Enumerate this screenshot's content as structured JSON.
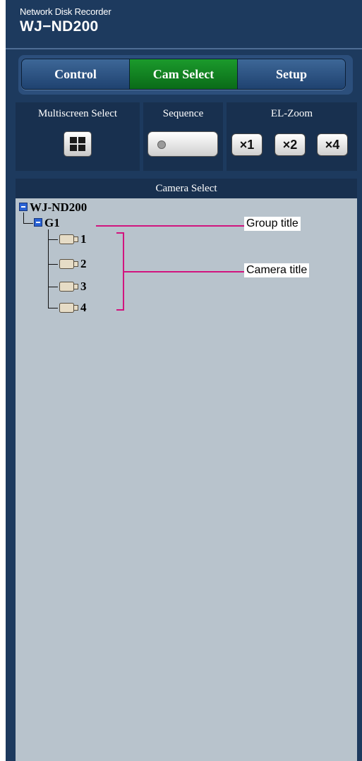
{
  "app": {
    "subtitle": "Network Disk Recorder",
    "title": "WJ−ND200"
  },
  "tabs": [
    {
      "label": "Control",
      "active": false
    },
    {
      "label": "Cam Select",
      "active": true
    },
    {
      "label": "Setup",
      "active": false
    }
  ],
  "controls": {
    "multiscreen": {
      "label": "Multiscreen Select",
      "icon": "quad-grid-icon"
    },
    "sequence": {
      "label": "Sequence",
      "icon": "indicator-dot-icon"
    },
    "zoom": {
      "label": "EL-Zoom",
      "buttons": [
        "×1",
        "×2",
        "×4"
      ]
    }
  },
  "camera_select": {
    "header": "Camera Select",
    "root": "WJ-ND200",
    "group": "G1",
    "cameras": [
      "1",
      "2",
      "3",
      "4"
    ]
  },
  "annotations": {
    "group_title": "Group title",
    "camera_title": "Camera title"
  },
  "colors": {
    "panel": "#1d3a5e",
    "active_tab": "#0a6b18",
    "tree_background": "#b8c3cc",
    "annotation_line": "#d1147e"
  }
}
